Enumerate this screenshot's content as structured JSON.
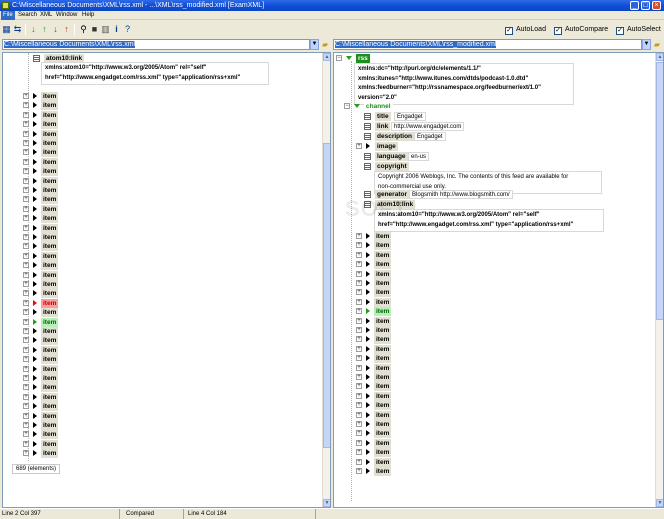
{
  "window": {
    "title": "C:\\Miscellaneous Documents\\XML\\rss.xml - ...\\XML\\rss_modified.xml [ExamXML]",
    "buttons": {
      "minimize": "_",
      "maximize": "□",
      "close": "×"
    }
  },
  "menu": [
    "File",
    "Search",
    "XML",
    "Window",
    "Help"
  ],
  "toolbar": {
    "checks": [
      {
        "label": "AutoLoad",
        "checked": true
      },
      {
        "label": "AutoCompare",
        "checked": true
      },
      {
        "label": "AutoSelect",
        "checked": true
      }
    ]
  },
  "left": {
    "path": "C:\\Miscellaneous Documents\\XML\\rss.xml",
    "atom_tag": "atom10:link",
    "atom_attrs": [
      "xmlns:atom10=\"http://www.w3.org/2005/Atom\" rel=\"self\"",
      "href=\"http://www.engadget.com/rss.xml\" type=\"application/rss+xml\""
    ],
    "item_label": "item",
    "items": [
      "n",
      "n",
      "n",
      "n",
      "n",
      "n",
      "n",
      "n",
      "n",
      "n",
      "n",
      "n",
      "n",
      "n",
      "n",
      "n",
      "n",
      "n",
      "n",
      "n",
      "n",
      "n",
      "r",
      "n",
      "g",
      "n",
      "n",
      "n",
      "n",
      "n",
      "n",
      "n",
      "n",
      "n",
      "n",
      "n",
      "n",
      "n",
      "n"
    ],
    "count_label": "689 (elements)"
  },
  "right": {
    "path": "C:\\Miscellaneous Documents\\XML\\rss_modified.xml",
    "root_tag": "rss",
    "root_attrs": [
      "xmlns:dc=\"http://purl.org/dc/elements/1.1/\"",
      "xmlns:itunes=\"http://www.itunes.com/dtds/podcast-1.0.dtd\"",
      "xmlns:feedburner=\"http://rssnamespace.org/feedburner/ext/1.0\"",
      "version=\"2.0\""
    ],
    "channel_tag": "channel",
    "fields": [
      {
        "tag": "title",
        "value": "Engadget"
      },
      {
        "tag": "link",
        "value": "http://www.engadget.com"
      },
      {
        "tag": "description",
        "value": "Engadget"
      }
    ],
    "image_tag": "image",
    "language": {
      "tag": "language",
      "value": "en-us"
    },
    "copyright_tag": "copyright",
    "copyright_text": [
      "Copyright 2006 Weblogs, Inc. The contents of this feed are available for",
      "non-commercial use only."
    ],
    "generator": {
      "tag": "generator",
      "value": "Blogsmith http://www.blogsmith.com/"
    },
    "atom_tag": "atom10:link",
    "atom_attrs": [
      "xmlns:atom10=\"http://www.w3.org/2005/Atom\" rel=\"self\"",
      "href=\"http://www.engadget.com/rss.xml\" type=\"application/rss+xml\""
    ],
    "item_label": "item",
    "items": [
      "n",
      "n",
      "n",
      "n",
      "n",
      "n",
      "n",
      "n",
      "g",
      "n",
      "n",
      "n",
      "n",
      "n",
      "n",
      "n",
      "n",
      "n",
      "n",
      "n",
      "n",
      "n",
      "n",
      "n",
      "n",
      "n"
    ]
  },
  "statusbar": {
    "left_pos": "Line 2 Col 397",
    "state": "Compared",
    "right_pos": "Line 4 Col 184"
  },
  "colors": {
    "accent": "#316ac5",
    "changed": "#ff0000",
    "added": "#1ea01e"
  }
}
